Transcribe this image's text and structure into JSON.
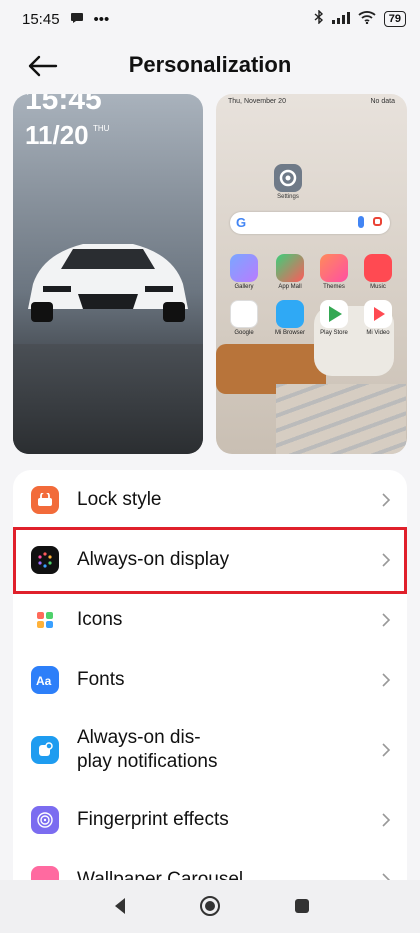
{
  "status": {
    "time": "15:45",
    "battery": "79"
  },
  "header": {
    "title": "Personalization"
  },
  "lock_preview": {
    "time": "15:45",
    "date": "11/20",
    "weekday": "THU"
  },
  "home_preview": {
    "date": "Thu, November 20",
    "weather": "No data",
    "settings_label": "Settings",
    "apps": [
      {
        "label": "Gallery"
      },
      {
        "label": "App Mall"
      },
      {
        "label": "Themes"
      },
      {
        "label": "Music"
      },
      {
        "label": "Google"
      },
      {
        "label": "Mi Browser"
      },
      {
        "label": "Play Store"
      },
      {
        "label": "Mi Video"
      }
    ]
  },
  "settings": {
    "items": [
      {
        "label": "Lock style",
        "icon": "lock-style-icon",
        "color": "#f26b3a"
      },
      {
        "label": "Always-on display",
        "icon": "always-on-display-icon",
        "color": "#111111"
      },
      {
        "label": "Icons",
        "icon": "icons-icon",
        "color": "#ffffff"
      },
      {
        "label": "Fonts",
        "icon": "fonts-icon",
        "color": "#2d7ff9"
      },
      {
        "label": "Always-on dis-\nplay notifications",
        "icon": "aod-notifications-icon",
        "color": "#1e9cf0"
      },
      {
        "label": "Fingerprint effects",
        "icon": "fingerprint-icon",
        "color": "#7b6cf0"
      },
      {
        "label": "Wallpaper Carousel",
        "icon": "wallpaper-carousel-icon",
        "color": "#ff6aa0"
      }
    ]
  },
  "highlight_color": "#e0202b"
}
